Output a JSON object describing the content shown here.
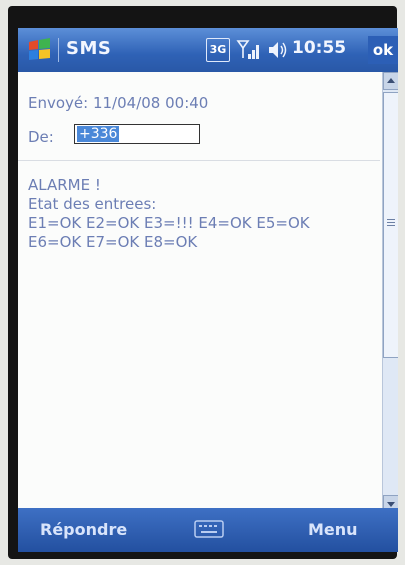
{
  "titlebar": {
    "app_title": "SMS",
    "network_indicator": "3G",
    "time": "10:55",
    "ok_label": "ok"
  },
  "message": {
    "sent_line": "Envoyé: 11/04/08 00:40",
    "from_label": "De:",
    "from_value": "+336",
    "body_lines": [
      "ALARME !",
      "Etat des entrees:",
      "E1=OK E2=OK E3=!!! E4=OK E5=OK",
      "E6=OK E7=OK E8=OK"
    ]
  },
  "softkeys": {
    "left": "Répondre",
    "right": "Menu"
  },
  "icons": {
    "start": "windows-flag-icon",
    "signal": "signal-icon",
    "speaker": "speaker-icon",
    "keyboard": "keyboard-icon"
  },
  "colors": {
    "titlebar": "#2f62b6",
    "text": "#6c7eb4",
    "selection": "#4a88d8"
  }
}
